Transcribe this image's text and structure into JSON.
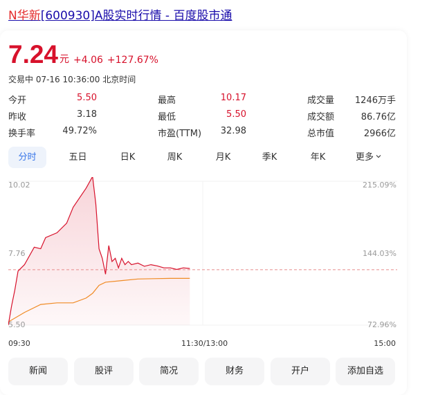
{
  "header": {
    "title_highlight": "N华新",
    "title_rest": "[600930]A股实时行情 - 百度股市通"
  },
  "quote": {
    "price": "7.24",
    "currency": "元",
    "change": "+4.06",
    "change_pct": "+127.67%",
    "status": "交易中 07-16 10:36:00 北京时间"
  },
  "stats": [
    {
      "label": "今开",
      "value": "5.50",
      "color": "red"
    },
    {
      "label": "昨收",
      "value": "3.18",
      "color": "dark"
    },
    {
      "label": "换手率",
      "value": "49.72%",
      "color": "dark"
    },
    {
      "label": "最高",
      "value": "10.17",
      "color": "red"
    },
    {
      "label": "最低",
      "value": "5.50",
      "color": "red"
    },
    {
      "label": "市盈(TTM)",
      "value": "32.98",
      "color": "dark"
    },
    {
      "label": "成交量",
      "value": "1246万手",
      "color": "dark"
    },
    {
      "label": "成交额",
      "value": "86.76亿",
      "color": "dark"
    },
    {
      "label": "总市值",
      "value": "2966亿",
      "color": "dark"
    }
  ],
  "tabs": [
    "分时",
    "五日",
    "日K",
    "周K",
    "月K",
    "季K",
    "年K",
    "更多"
  ],
  "active_tab": "分时",
  "chart_data": {
    "type": "line",
    "y_left_ticks": [
      "10.02",
      "7.76",
      "5.50"
    ],
    "y_right_ticks": [
      "215.09%",
      "144.03%",
      "72.96%"
    ],
    "x_ticks": [
      "09:30",
      "11:30/13:00",
      "15:00"
    ],
    "ylim": [
      5.5,
      10.02
    ],
    "prev_close_ref": 7.24,
    "series": [
      {
        "color": "#d7112b",
        "values": [
          [
            0,
            5.5
          ],
          [
            2,
            6.1
          ],
          [
            4,
            6.6
          ],
          [
            6,
            7.2
          ],
          [
            10,
            7.4
          ],
          [
            16,
            7.95
          ],
          [
            20,
            7.9
          ],
          [
            23,
            8.25
          ],
          [
            30,
            8.4
          ],
          [
            36,
            8.7
          ],
          [
            40,
            9.2
          ],
          [
            48,
            9.8
          ],
          [
            52,
            10.17
          ],
          [
            54,
            9.3
          ],
          [
            56,
            7.9
          ],
          [
            58,
            7.6
          ],
          [
            60,
            7.1
          ],
          [
            62,
            8.0
          ],
          [
            64,
            7.5
          ],
          [
            66,
            7.6
          ],
          [
            68,
            7.3
          ],
          [
            70,
            7.6
          ],
          [
            72,
            7.4
          ],
          [
            74,
            7.5
          ],
          [
            76,
            7.4
          ],
          [
            80,
            7.45
          ],
          [
            84,
            7.35
          ],
          [
            88,
            7.4
          ],
          [
            92,
            7.36
          ],
          [
            96,
            7.3
          ],
          [
            100,
            7.3
          ],
          [
            104,
            7.25
          ],
          [
            108,
            7.3
          ],
          [
            112,
            7.28
          ]
        ]
      },
      {
        "color": "#f08a23",
        "values": [
          [
            0,
            5.6
          ],
          [
            10,
            5.9
          ],
          [
            20,
            6.15
          ],
          [
            30,
            6.2
          ],
          [
            40,
            6.2
          ],
          [
            48,
            6.35
          ],
          [
            52,
            6.5
          ],
          [
            56,
            6.75
          ],
          [
            60,
            6.85
          ],
          [
            70,
            6.9
          ],
          [
            80,
            6.95
          ],
          [
            90,
            6.96
          ],
          [
            100,
            6.97
          ],
          [
            112,
            6.97
          ]
        ]
      }
    ]
  },
  "buttons": [
    "新闻",
    "股评",
    "简况",
    "财务",
    "开户",
    "添加自选"
  ],
  "colors": {
    "up": "#d7112b",
    "avg": "#f08a23",
    "link": "#1a0dab",
    "accent": "#3a77e8"
  }
}
